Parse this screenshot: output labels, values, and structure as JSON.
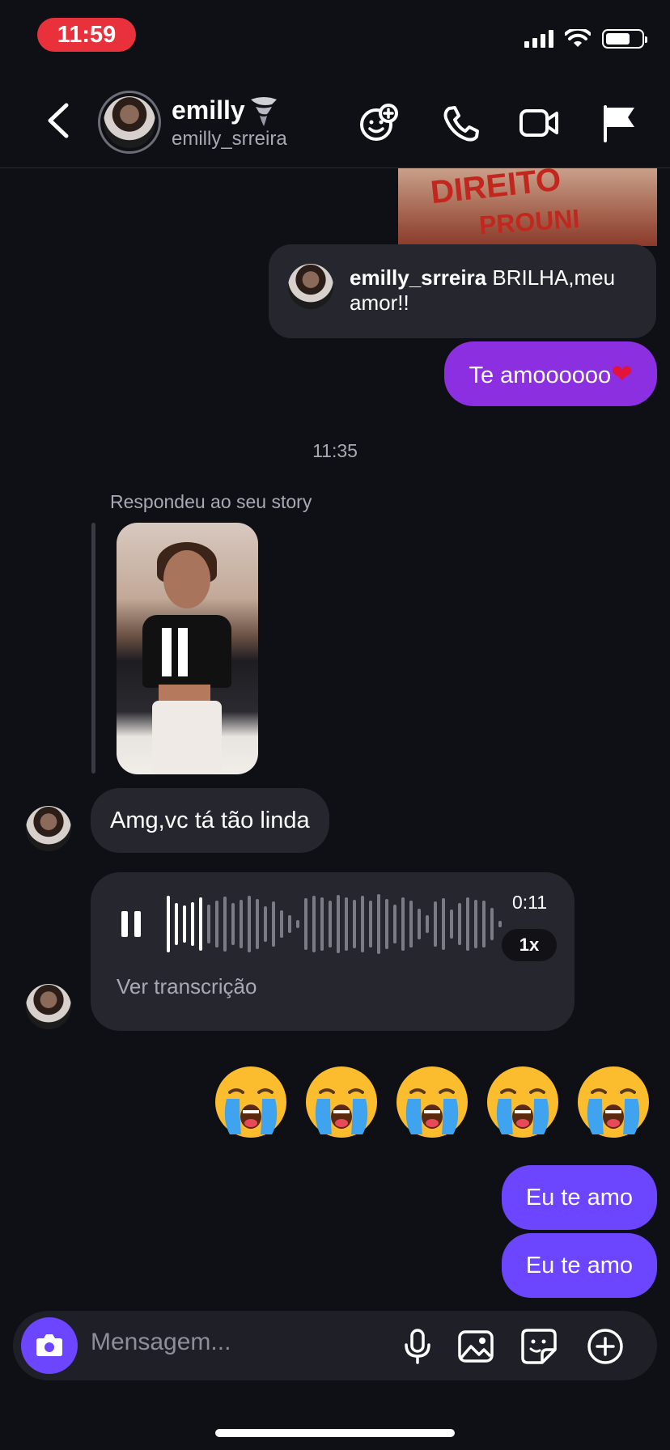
{
  "status_bar": {
    "time": "11:59"
  },
  "header": {
    "name": "emilly",
    "username": "emilly_srreira",
    "icons": [
      "add-reaction-icon",
      "phone-icon",
      "video-icon",
      "flag-icon"
    ]
  },
  "messages": {
    "story_image_text_1": "DIREITO",
    "story_image_text_2": "PROUNI",
    "reply_card": {
      "user": "emilly_srreira",
      "text": "BRILHA,meu amor!!"
    },
    "sent_1": "Te amoooooo",
    "timestamp": "11:35",
    "replied_label": "Respondeu ao seu story",
    "received_1": "Amg,vc tá tão linda",
    "voice": {
      "duration": "0:11",
      "speed": "1x",
      "transcript_label": "Ver transcrição"
    },
    "emoji_count": 5,
    "sent_2": "Eu te amo",
    "sent_3": "Eu te amo"
  },
  "composer": {
    "placeholder": "Mensagem...",
    "icons": [
      "camera-icon",
      "microphone-icon",
      "gallery-icon",
      "sticker-icon",
      "plus-icon"
    ]
  },
  "colors": {
    "background": "#0f0f16",
    "sent_purple": "#8b2fe0",
    "sent_blue": "#6b45ff",
    "received": "#26262f",
    "time_pill": "#e9313b"
  }
}
